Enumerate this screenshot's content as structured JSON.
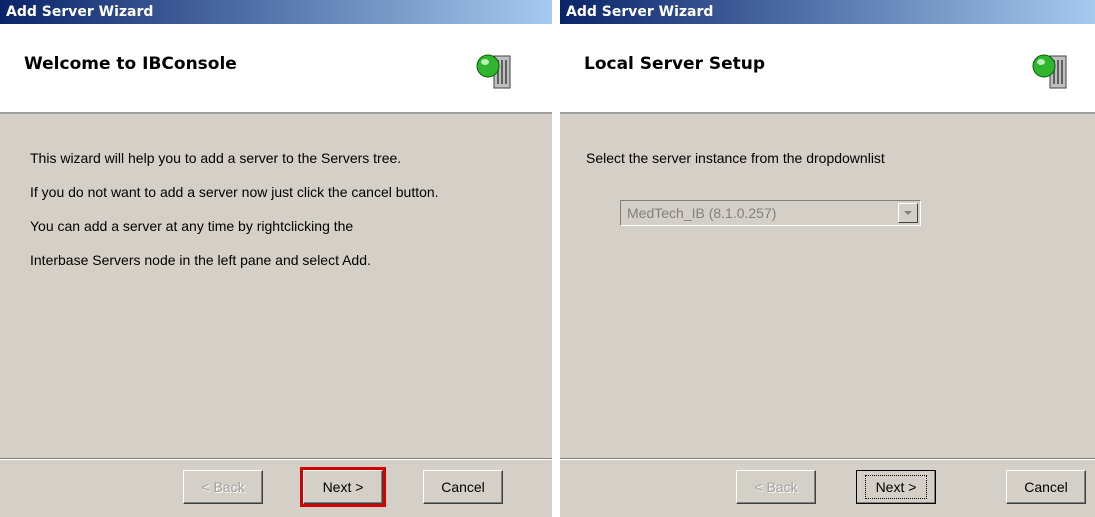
{
  "left_window": {
    "title": "Add Server Wizard",
    "header": "Welcome to IBConsole",
    "lines": [
      "This wizard will help you to add a server to the Servers tree.",
      "If you do not want to add a server now just click the cancel button.",
      "You can add a server at any time by rightclicking the",
      "Interbase Servers node in the left pane and select Add."
    ],
    "buttons": {
      "back": "< Back",
      "next": "Next >",
      "cancel": "Cancel"
    }
  },
  "right_window": {
    "title": "Add Server Wizard",
    "header": "Local Server Setup",
    "instruction": "Select the server instance from the dropdownlist",
    "dropdown_value": "MedTech_IB (8.1.0.257)",
    "buttons": {
      "back": "< Back",
      "next": "Next >",
      "cancel": "Cancel"
    }
  },
  "colors": {
    "title_gradient_start": "#0a246a",
    "title_gradient_end": "#a6caf0",
    "highlight": "#d40000",
    "dialog_bg": "#d4d0c8"
  },
  "icons": [
    "server-globe-icon",
    "dropdown-arrow-icon"
  ]
}
